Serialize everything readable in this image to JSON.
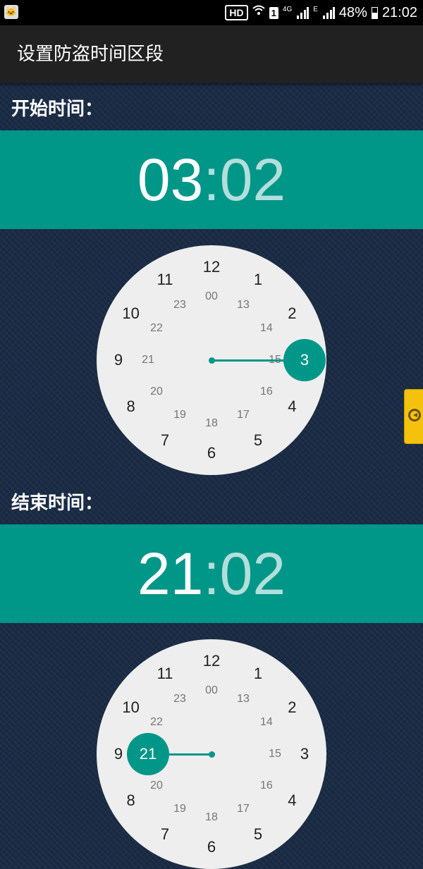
{
  "status_bar": {
    "hd": "HD",
    "sim": "1",
    "net_4g": "4G",
    "net_e": "E",
    "battery": "48%",
    "time": "21:02"
  },
  "app_bar": {
    "title": "设置防盗时间区段"
  },
  "start": {
    "label": "开始时间：",
    "hour": "03",
    "separator": ":",
    "minute": "02",
    "selected_label": "3"
  },
  "end": {
    "label": "结束时间：",
    "hour": "21",
    "separator": ":",
    "minute": "02",
    "selected_label": "21"
  },
  "clock": {
    "outer_numbers": [
      "12",
      "1",
      "2",
      "3",
      "4",
      "5",
      "6",
      "7",
      "8",
      "9",
      "10",
      "11"
    ],
    "inner_numbers": [
      "00",
      "13",
      "14",
      "15",
      "16",
      "17",
      "18",
      "19",
      "20",
      "21",
      "22",
      "23"
    ]
  },
  "colors": {
    "accent": "#009688",
    "accent_dim": "#b2dfdb",
    "app_bar": "#212121",
    "dial": "#eeeeee"
  },
  "icons": {
    "app": "cat-icon",
    "wifi": "wifi-icon",
    "signal": "signal-icon",
    "battery": "battery-icon",
    "side_tab": "floating-toolbar-icon"
  }
}
